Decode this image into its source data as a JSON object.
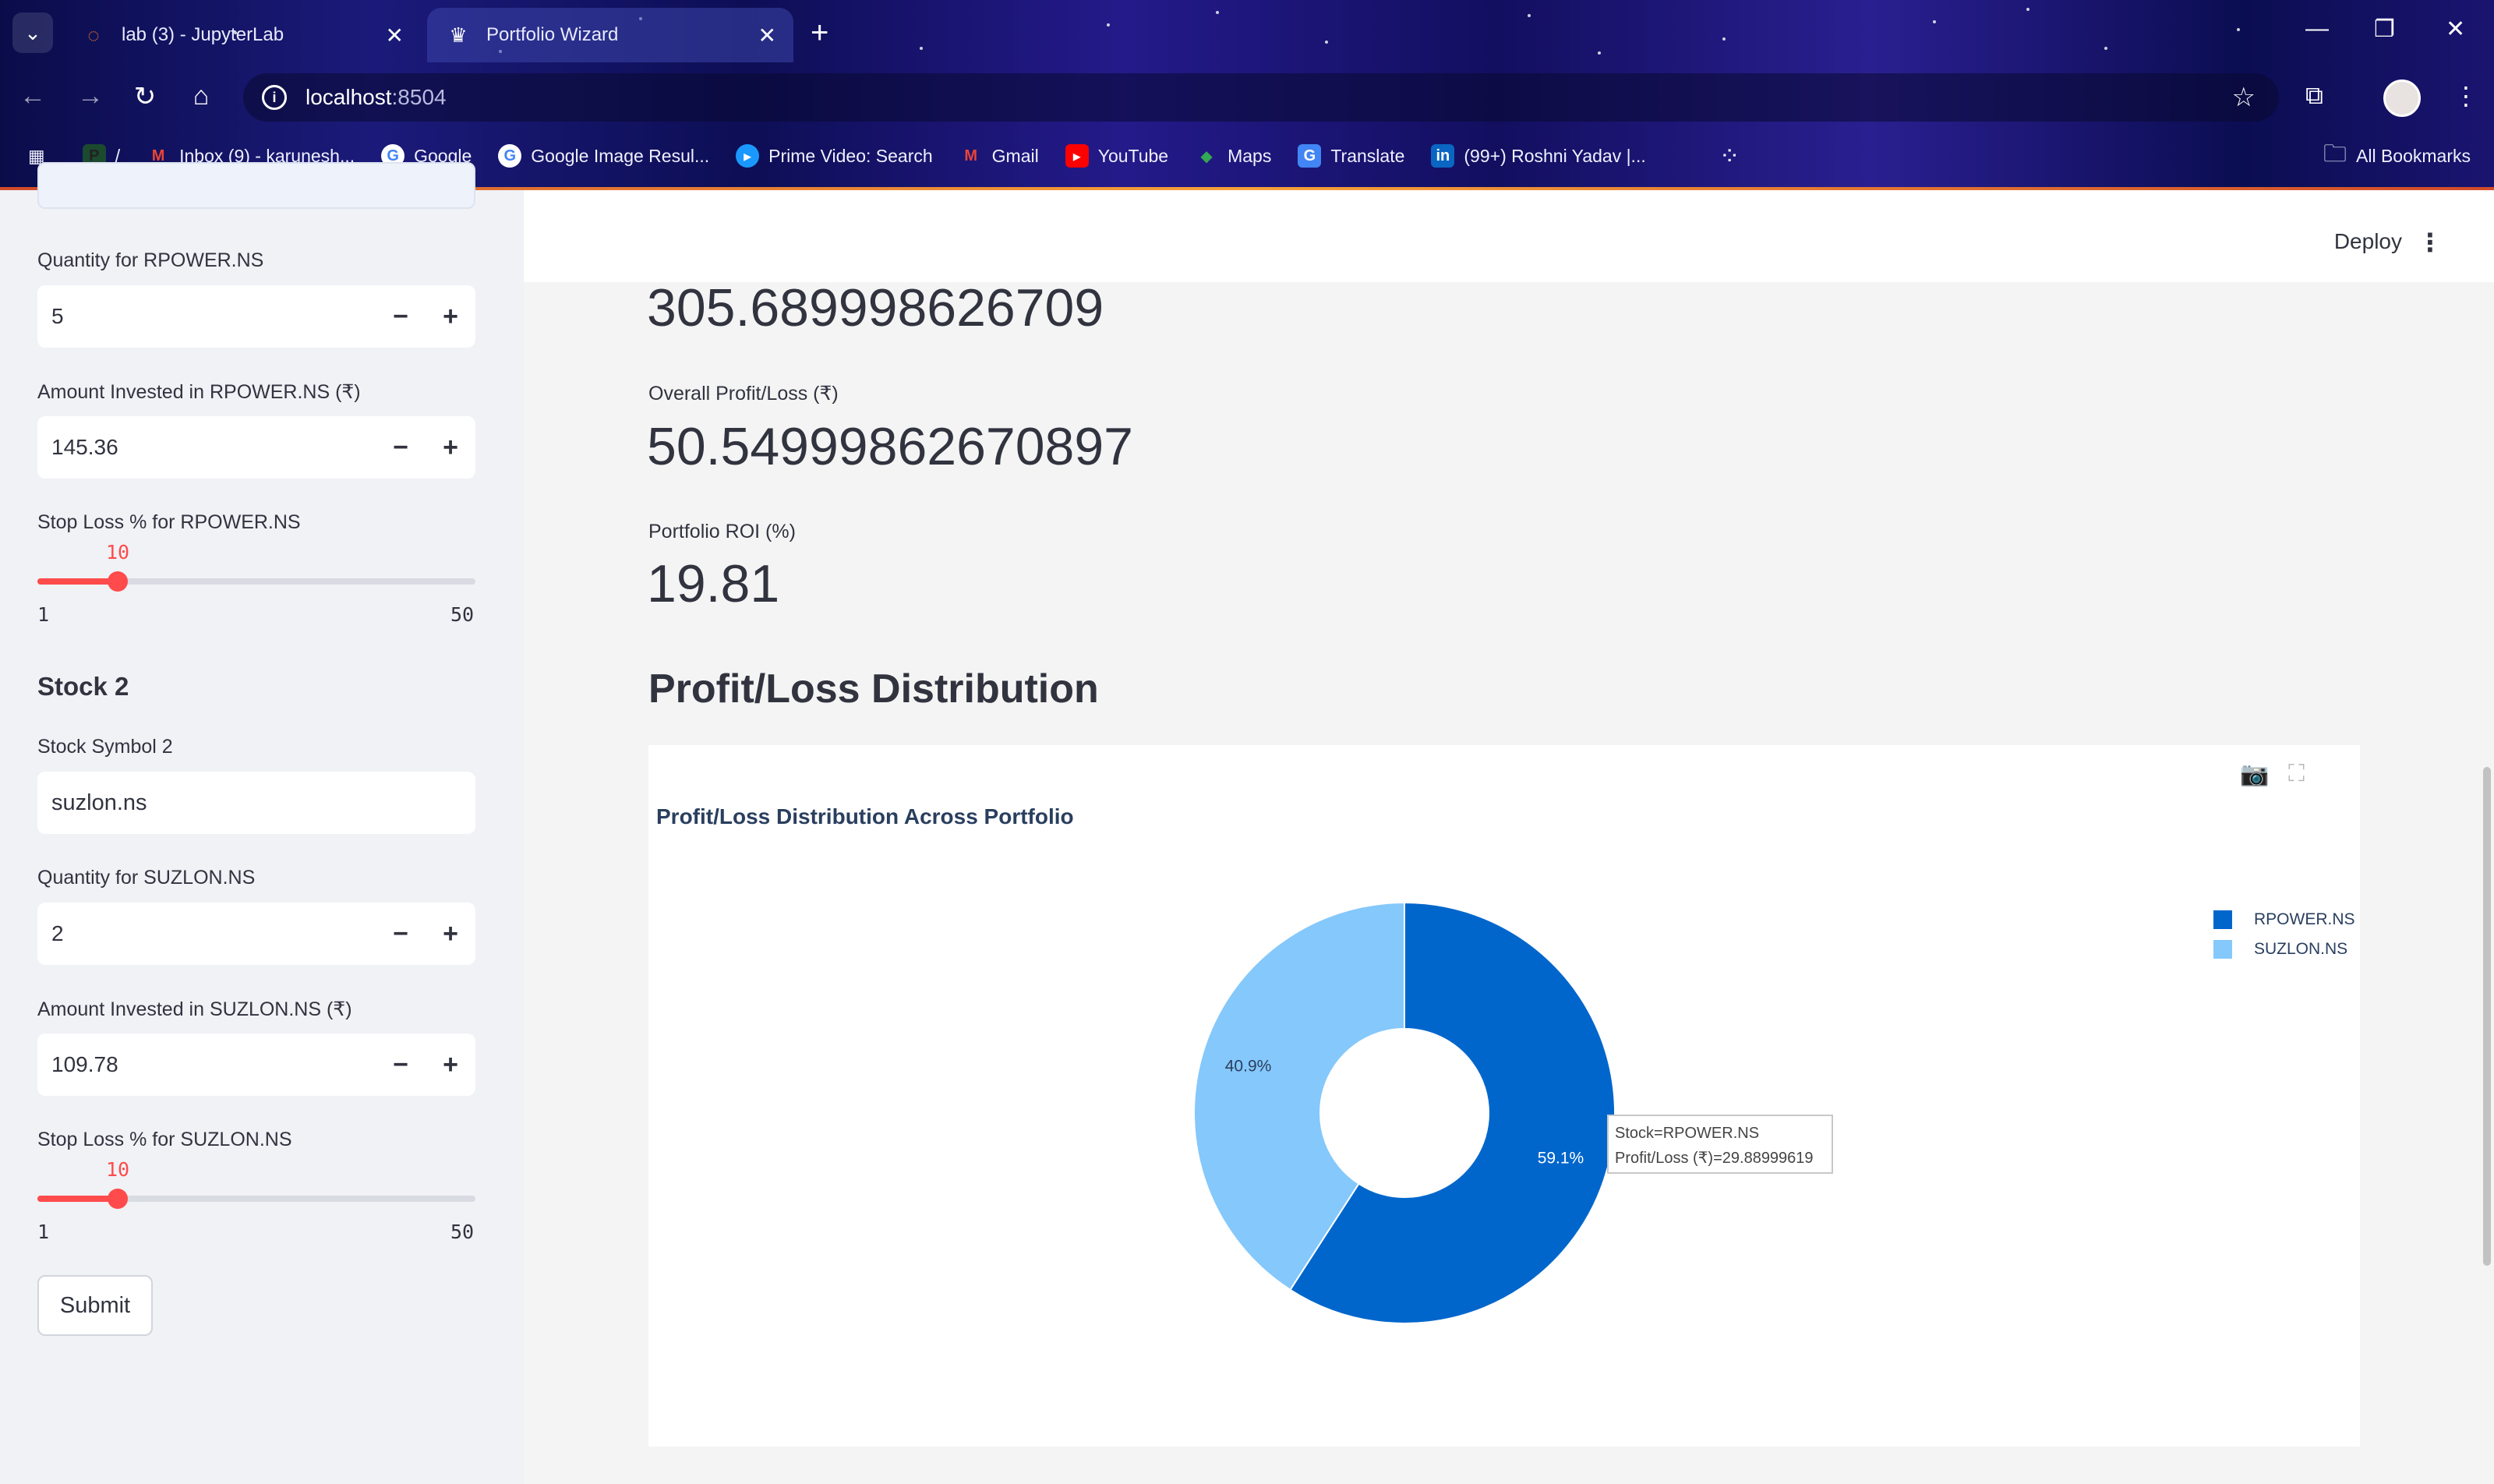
{
  "browser": {
    "tabs": [
      {
        "title": "lab (3) - JupyterLab",
        "icon": "jupyter-icon",
        "active": false
      },
      {
        "title": "Portfolio Wizard",
        "icon": "crown-icon",
        "active": true
      }
    ],
    "url_host": "localhost",
    "url_port": ":8504",
    "bookmarks": [
      {
        "label": "/",
        "icon": "pin-icon"
      },
      {
        "label": "Inbox (9) - karunesh...",
        "icon": "gmail-icon"
      },
      {
        "label": "Google",
        "icon": "google-icon"
      },
      {
        "label": "Google Image Resul...",
        "icon": "google-icon"
      },
      {
        "label": "Prime Video: Search",
        "icon": "prime-video-icon"
      },
      {
        "label": "Gmail",
        "icon": "gmail-icon"
      },
      {
        "label": "YouTube",
        "icon": "youtube-icon"
      },
      {
        "label": "Maps",
        "icon": "maps-icon"
      },
      {
        "label": "Translate",
        "icon": "translate-icon"
      },
      {
        "label": "(99+) Roshni Yadav |...",
        "icon": "linkedin-icon"
      }
    ],
    "all_bookmarks": "All Bookmarks"
  },
  "sidebar": {
    "stock1": {
      "quantity_label": "Quantity for RPOWER.NS",
      "quantity": "5",
      "amount_label": "Amount Invested in RPOWER.NS (₹)",
      "amount": "145.36",
      "stoploss_label": "Stop Loss % for RPOWER.NS",
      "stoploss_value": "10",
      "stoploss_min": "1",
      "stoploss_max": "50"
    },
    "stock2": {
      "heading": "Stock 2",
      "symbol_label": "Stock Symbol 2",
      "symbol": "suzlon.ns",
      "quantity_label": "Quantity for SUZLON.NS",
      "quantity": "2",
      "amount_label": "Amount Invested in SUZLON.NS (₹)",
      "amount": "109.78",
      "stoploss_label": "Stop Loss % for SUZLON.NS",
      "stoploss_value": "10",
      "stoploss_min": "1",
      "stoploss_max": "50"
    },
    "submit_label": "Submit"
  },
  "header": {
    "deploy_label": "Deploy"
  },
  "metrics": {
    "top_value": "305.689998626709",
    "overall_label": "Overall Profit/Loss (₹)",
    "overall_value": "50.54999862670897",
    "roi_label": "Portfolio ROI (%)",
    "roi_value": "19.81"
  },
  "section_heading": "Profit/Loss Distribution",
  "chart_data": {
    "type": "pie",
    "title": "Profit/Loss Distribution Across Portfolio",
    "hole": 0.4,
    "labels": [
      "RPOWER.NS",
      "SUZLON.NS"
    ],
    "values": [
      29.88999619,
      20.66000243
    ],
    "percent_labels": [
      "59.1%",
      "40.9%"
    ],
    "colors": [
      "#0066cc",
      "#85c8fb"
    ],
    "legend_position": "top-right",
    "hover": {
      "line1": "Stock=RPOWER.NS",
      "line2": "Profit/Loss (₹)=29.88999619"
    }
  }
}
